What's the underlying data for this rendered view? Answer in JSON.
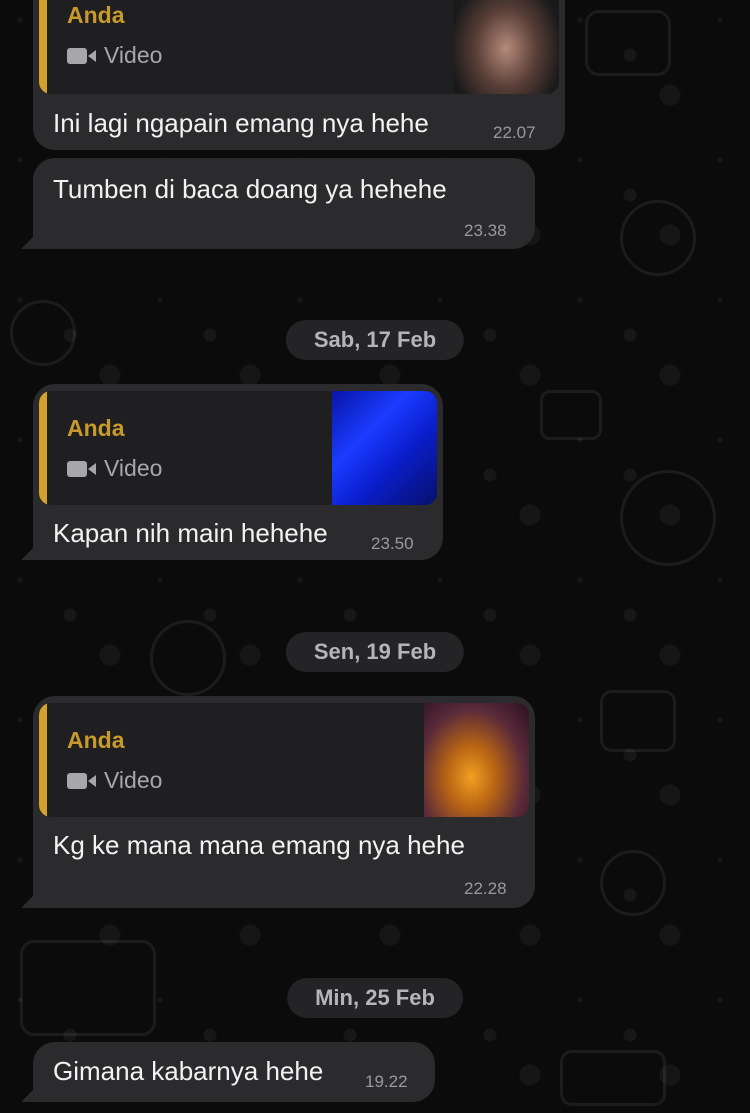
{
  "messages": [
    {
      "sender": "Anda",
      "attachment": "Video",
      "text": "Ini lagi ngapain emang nya hehe",
      "time": "22.07"
    },
    {
      "text": "Tumben di baca doang ya hehehe",
      "time": "23.38"
    },
    {
      "date": "Sab, 17 Feb"
    },
    {
      "sender": "Anda",
      "attachment": "Video",
      "text": "Kapan nih main hehehe",
      "time": "23.50"
    },
    {
      "date": "Sen, 19 Feb"
    },
    {
      "sender": "Anda",
      "attachment": "Video",
      "text": "Kg ke mana mana emang nya hehe",
      "time": "22.28"
    },
    {
      "date": "Min, 25 Feb"
    },
    {
      "text": "Gimana kabarnya hehe",
      "time": "19.22"
    }
  ],
  "colors": {
    "bubble": "#2b2b2d",
    "quote_bg": "#1f1f21",
    "quote_accent": "#d4a12a",
    "sender_name": "#c89a2b",
    "background": "#0b0b0b"
  },
  "icons": [
    "video-camera-icon"
  ]
}
